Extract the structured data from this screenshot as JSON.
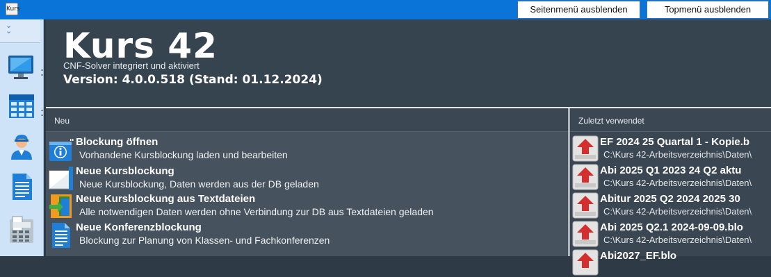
{
  "titlebar": {
    "app_icon_text": "Kurs",
    "buttons": {
      "hide_side_menu": "Seitenmenü ausblenden",
      "hide_top_menu": "Topmenü ausblenden"
    },
    "accent": "#0a74d9"
  },
  "sidebar": {
    "collapse_icon": "double-chevron-down-icon",
    "items": [
      {
        "icon": "monitor-icon"
      },
      {
        "icon": "table-grid-icon"
      },
      {
        "icon": "user-icon"
      },
      {
        "icon": "document-icon"
      },
      {
        "icon": "calculator-icon"
      }
    ]
  },
  "header": {
    "title": "Kurs 42",
    "subtitle": "CNF-Solver integriert und aktiviert",
    "version": "Version: 4.0.0.518 (Stand: 01.12.2024)"
  },
  "new_panel": {
    "heading": "Neu",
    "items": [
      {
        "icon": "info-icon",
        "title": "Blockung öffnen",
        "desc": "Vorhandene Kursblockung laden und bearbeiten"
      },
      {
        "icon": "new-blockung-icon",
        "title": "Neue Kursblockung",
        "desc": "Neue Kursblockung, Daten werden aus der DB geladen"
      },
      {
        "icon": "import-door-icon",
        "title": "Neue Kursblockung aus Textdateien",
        "desc": "Alle notwendigen Daten werden ohne Verbindung zur DB aus Textdateien geladen"
      },
      {
        "icon": "conference-document-icon",
        "title": "Neue Konferenzblockung",
        "desc": "Blockung zur Planung von Klassen- und Fachkonferenzen"
      }
    ]
  },
  "recent_panel": {
    "heading": "Zuletzt verwendet",
    "items": [
      {
        "title": "EF 2024 25 Quartal 1 - Kopie.b",
        "path": "C:\\Kurs 42-Arbeitsverzeichnis\\Daten\\"
      },
      {
        "title": "Abi 2025 Q1 2023 24 Q2 aktu",
        "path": "C:\\Kurs 42-Arbeitsverzeichnis\\Daten\\"
      },
      {
        "title": "Abitur 2025 Q2 2024 2025 30",
        "path": "C:\\Kurs 42-Arbeitsverzeichnis\\Daten\\"
      },
      {
        "title": "Abi 2025 Q2.1 2024-09-09.blo",
        "path": "C:\\Kurs 42-Arbeitsverzeichnis\\Daten\\"
      },
      {
        "title": "Abi2027_EF.blo",
        "path": ""
      }
    ]
  }
}
